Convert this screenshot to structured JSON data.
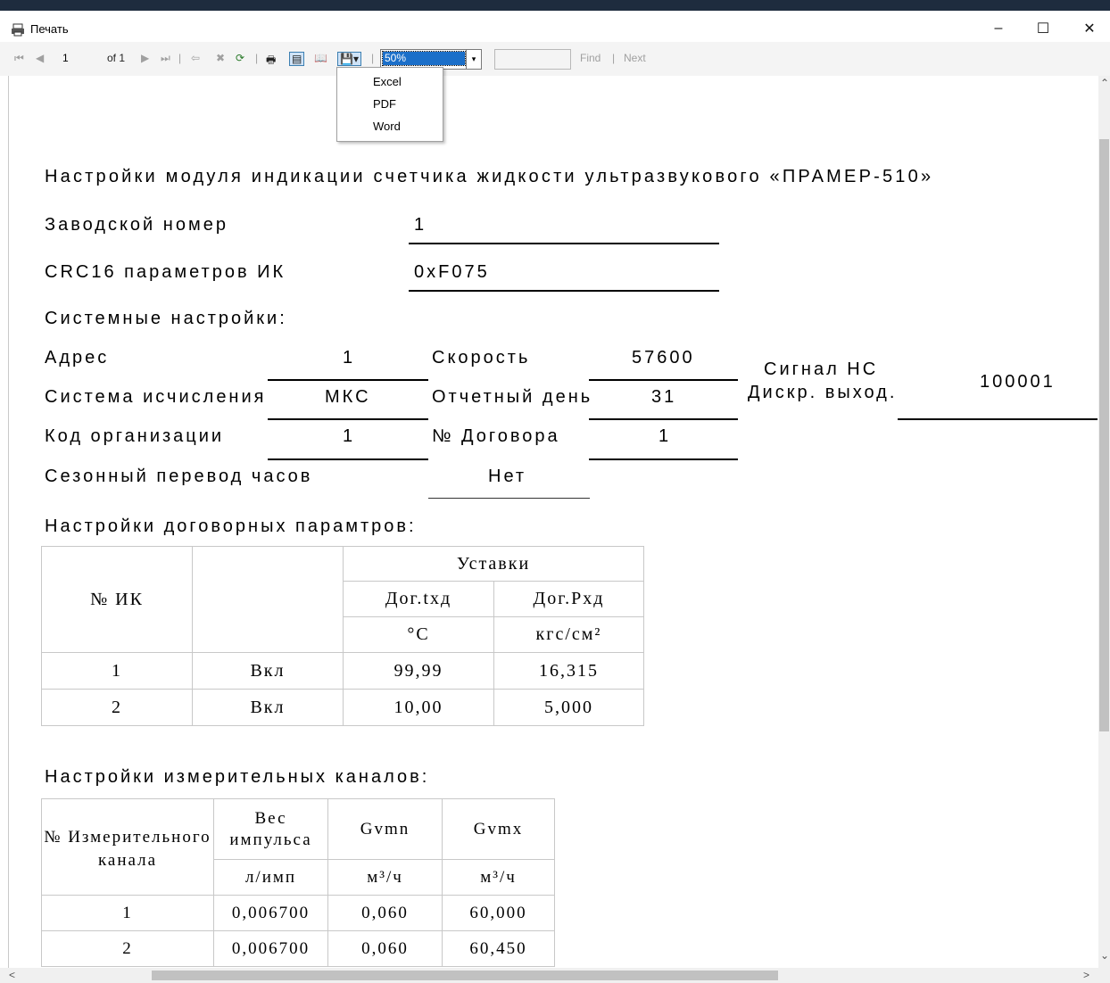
{
  "window": {
    "title": "Печать",
    "minimize": "–",
    "maximize": "☐",
    "close": "✕"
  },
  "toolbar": {
    "first": "⏮",
    "prev": "◀",
    "page": "1",
    "of": "of 1",
    "next": "▶",
    "last": "⏭",
    "back": "⇦",
    "stop": "✖",
    "refresh": "⟳",
    "print": "🖶",
    "layout": "▤",
    "pagesetup": "📖",
    "export": "💾▾",
    "zoom": "50%",
    "zoom_arrow": "▾",
    "find": "Find",
    "sep": "|",
    "next_label": "Next"
  },
  "export_menu": [
    "Excel",
    "PDF",
    "Word"
  ],
  "report": {
    "title": "Настройки модуля индикации счетчика жидкости ультразвукового «ПРАМЕР-510»",
    "serial_label": "Заводской номер",
    "serial_value": "1",
    "crc_label": "CRC16 параметров ИК",
    "crc_value": "0xF075",
    "system_header": "Системные настройки:",
    "address_label": "Адрес",
    "address_value": "1",
    "speed_label": "Скорость",
    "speed_value": "57600",
    "numsys_label": "Система исчисления",
    "numsys_value": "МКС",
    "report_day_label": "Отчетный день",
    "report_day_value": "31",
    "org_label": "Код организации",
    "org_value": "1",
    "contract_label": "№ Договора",
    "contract_value": "1",
    "dst_label": "Сезонный перевод часов",
    "dst_value": "Нет",
    "signal_label1": "Сигнал НС",
    "signal_label2": "Дискр. выход.",
    "signal_value": "100001",
    "contract_header": "Настройки договорных парамтров:",
    "t1": {
      "col_ik": "№ ИК",
      "setpoints": "Уставки",
      "col_t": "Дог.tхд",
      "col_p": "Дог.Рхд",
      "unit_t": "°С",
      "unit_p": "кгс/см²",
      "rows": [
        {
          "n": "1",
          "state": "Вкл",
          "t": "99,99",
          "p": "16,315"
        },
        {
          "n": "2",
          "state": "Вкл",
          "t": "10,00",
          "p": "5,000"
        }
      ]
    },
    "channels_header": "Настройки измерительных каналов:",
    "t2": {
      "col_n": "№ Измерительного канала",
      "col_w": "Вес импульса",
      "col_min": "Gvmn",
      "col_max": "Gvmx",
      "unit_w": "л/имп",
      "unit_min": "м³/ч",
      "unit_max": "м³/ч",
      "rows": [
        {
          "n": "1",
          "w": "0,006700",
          "min": "0,060",
          "max": "60,000"
        },
        {
          "n": "2",
          "w": "0,006700",
          "min": "0,060",
          "max": "60,450"
        }
      ]
    }
  },
  "scroll": {
    "up": "⌃",
    "down": "⌄",
    "left": "<",
    "right": ">"
  },
  "colors": {
    "accent": "#1b6fc9",
    "titlestrip": "#1e2c3e"
  }
}
